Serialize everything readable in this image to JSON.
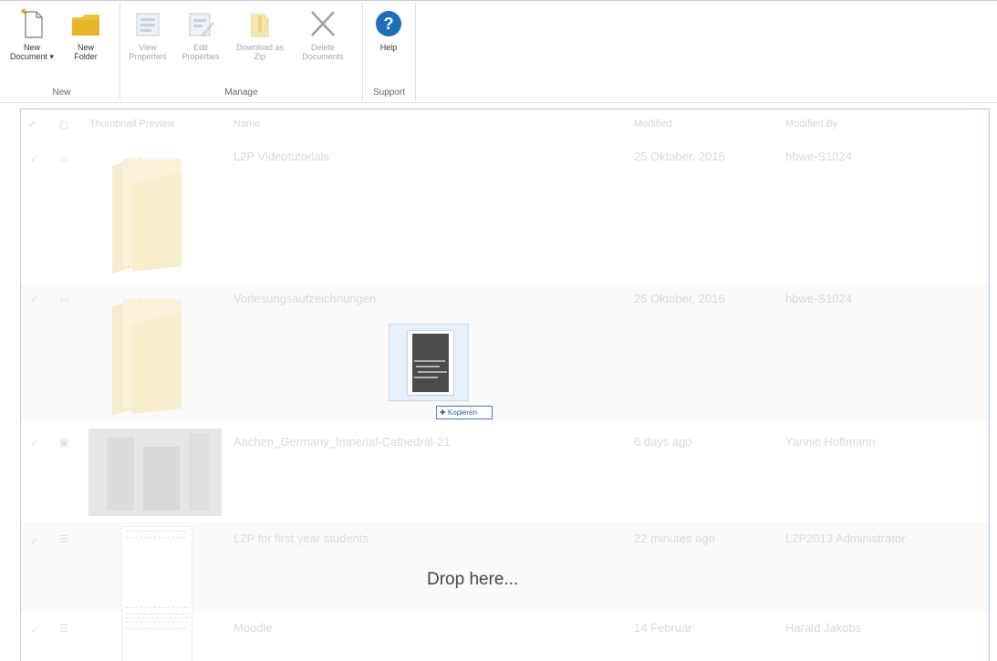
{
  "ribbon": {
    "groups": [
      {
        "label": "New"
      },
      {
        "label": "Manage"
      },
      {
        "label": "Support"
      }
    ],
    "buttons": {
      "new_document": "New\nDocument ▾",
      "new_folder": "New\nFolder",
      "view_properties": "View\nProperties",
      "edit_properties": "Edit\nProperties",
      "download_zip": "Download as\nZip",
      "delete_documents": "Delete\nDocuments",
      "help": "Help"
    }
  },
  "list": {
    "columns": {
      "type": "",
      "thumbnail": "Thumbnail Preview",
      "name": "Name",
      "modified": "Modified",
      "modified_by": "Modified By"
    },
    "rows": [
      {
        "name": "L2P Videotutorials",
        "modified": "25 Oktober, 2016",
        "modified_by": "hbwe-S1024"
      },
      {
        "name": "Vorlesungsaufzeichnungen",
        "modified": "25 Oktober, 2016",
        "modified_by": "hbwe-S1024"
      },
      {
        "name": "Aachen_Germany_Imperial-Cathedral-21",
        "modified": "6 days ago",
        "modified_by": "Yannic Hoffmann"
      },
      {
        "name": "L2P for first year students",
        "modified": "22 minutes ago",
        "modified_by": "L2P2013 Administrator"
      },
      {
        "name": "Moodle",
        "modified": "14 Februar",
        "modified_by": "Harald Jakobs"
      }
    ]
  },
  "drag": {
    "badge": "✚ Kopieren"
  },
  "drop_text": "Drop here..."
}
